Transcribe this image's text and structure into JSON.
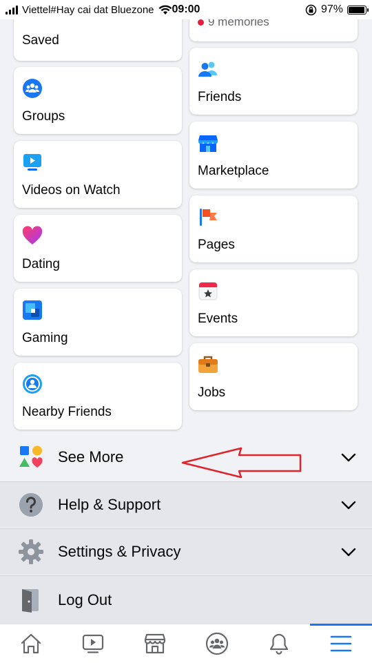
{
  "status_bar": {
    "carrier": "Viettel#Hay cai dat Bluezone",
    "time": "09:00",
    "battery": "97%",
    "battery_level": 0.97
  },
  "shortcuts": {
    "saved": {
      "label": "Saved",
      "icon": "bookmark-icon"
    },
    "memories": {
      "label": "9 memories",
      "icon": "red-dot"
    },
    "groups": {
      "label": "Groups",
      "icon": "groups-icon"
    },
    "friends": {
      "label": "Friends",
      "icon": "friends-icon"
    },
    "videos_on_watch": {
      "label": "Videos on Watch",
      "icon": "watch-video-icon"
    },
    "marketplace": {
      "label": "Marketplace",
      "icon": "marketplace-store-icon"
    },
    "dating": {
      "label": "Dating",
      "icon": "dating-heart-icon"
    },
    "pages": {
      "label": "Pages",
      "icon": "pages-flag-icon"
    },
    "gaming": {
      "label": "Gaming",
      "icon": "gaming-icon"
    },
    "events": {
      "label": "Events",
      "icon": "events-calendar-icon"
    },
    "nearby_friends": {
      "label": "Nearby Friends",
      "icon": "nearby-friends-icon"
    },
    "jobs": {
      "label": "Jobs",
      "icon": "jobs-briefcase-icon"
    }
  },
  "menu": {
    "see_more": "See More",
    "help_support": "Help & Support",
    "settings_privacy": "Settings & Privacy",
    "log_out": "Log Out"
  },
  "bottom_nav": [
    "home-icon",
    "watch-icon",
    "marketplace-icon",
    "groups-icon",
    "notifications-bell-icon",
    "menu-hamburger-icon"
  ],
  "colors": {
    "accent": "#1877f2",
    "annotation_arrow": "#e0242b",
    "background": "#f0f2f5",
    "row_background": "#e4e6eb"
  }
}
